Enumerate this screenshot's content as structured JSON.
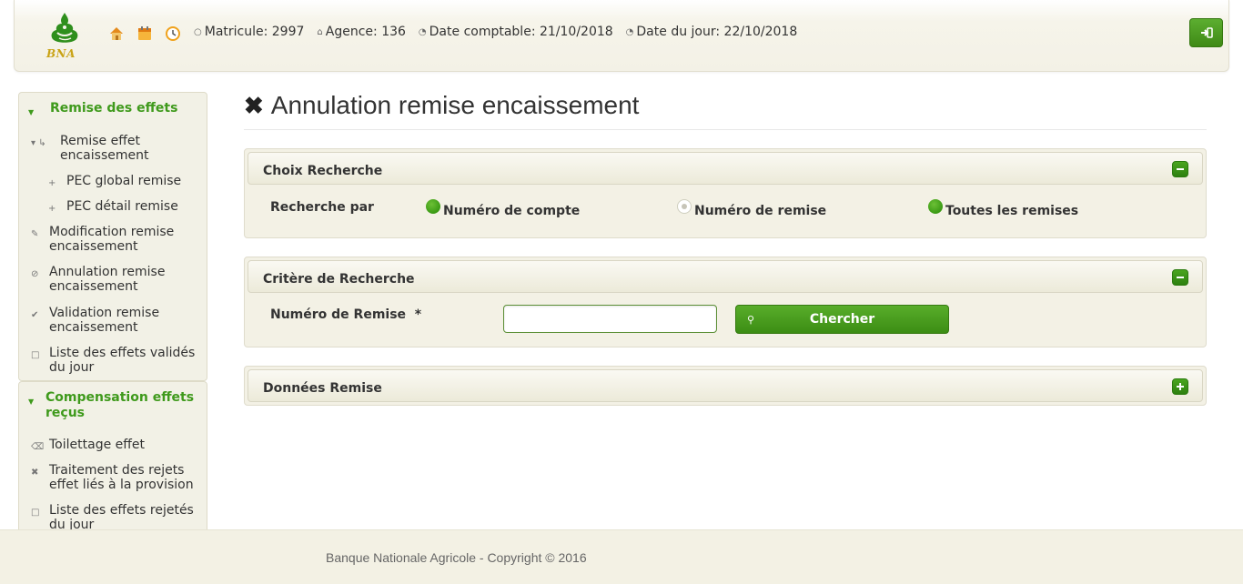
{
  "header": {
    "logo_text": "BNA",
    "icons": [
      "home-icon",
      "calendar-icon",
      "clock-icon"
    ],
    "info": {
      "matricule": "Matricule: 2997",
      "agence": "Agence: 136",
      "date_comptable": "Date comptable: 21/10/2018",
      "date_jour": "Date du jour: 22/10/2018"
    },
    "logout_icon": "logout-icon"
  },
  "sidebar": {
    "section1": {
      "title": "Remise des effets",
      "items": [
        {
          "label": "Remise effet encaissement",
          "icon": "share-icon"
        },
        {
          "label": "PEC global remise",
          "icon": "plus-icon"
        },
        {
          "label": "PEC détail remise",
          "icon": "plus-icon"
        },
        {
          "label": "Modification remise encaissement",
          "icon": "pencil-icon"
        },
        {
          "label": "Annulation remise encaissement",
          "icon": "ban-icon"
        },
        {
          "label": "Validation remise encaissement",
          "icon": "check-icon"
        },
        {
          "label": "Liste des effets validés du jour",
          "icon": "file-icon"
        }
      ]
    },
    "section2": {
      "title": "Compensation effets reçus",
      "items": [
        {
          "label": "Toilettage effet",
          "icon": "trash-icon"
        },
        {
          "label": "Traitement des rejets effet liés à la provision",
          "icon": "x-icon"
        },
        {
          "label": "Liste des effets rejetés du jour",
          "icon": "file-icon"
        }
      ]
    }
  },
  "main": {
    "title": "Annulation remise encaissement",
    "panel_choix": {
      "title": "Choix Recherche",
      "label": "Recherche par",
      "options": [
        {
          "label": "Numéro de compte",
          "selected": false
        },
        {
          "label": "Numéro de remise",
          "selected": true
        },
        {
          "label": "Toutes les remises",
          "selected": false
        }
      ]
    },
    "panel_critere": {
      "title": "Critère de Recherche",
      "label": "Numéro de Remise  *",
      "input_value": "",
      "button": "Chercher"
    },
    "panel_donnees": {
      "title": "Données Remise"
    }
  },
  "footer": {
    "copyright": "Banque Nationale Agricole - Copyright © 2016"
  },
  "colors": {
    "accent": "#3f9a1c",
    "button": "#4a9c1f",
    "panel_bg": "#f3f1e5"
  }
}
